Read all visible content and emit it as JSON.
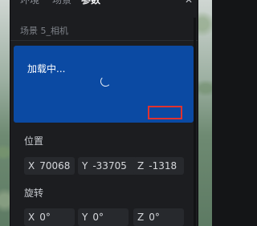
{
  "tabs": [
    {
      "label": "环境"
    },
    {
      "label": "场景"
    },
    {
      "label": "参数"
    }
  ],
  "close_icon": "close-icon",
  "scene_title": "场景 5_相机",
  "preview": {
    "status_text": "加载中...",
    "spinner_icon": "spinner-icon",
    "background_color": "#0b4aa3",
    "highlight_color": "#e0322f"
  },
  "position": {
    "label": "位置",
    "x": {
      "axis": "X",
      "value": "70068"
    },
    "y": {
      "axis": "Y",
      "value": "-33705"
    },
    "z": {
      "axis": "Z",
      "value": "-1318"
    }
  },
  "rotation": {
    "label": "旋转",
    "x": {
      "axis": "X",
      "value": "0°"
    },
    "y": {
      "axis": "Y",
      "value": "0°"
    },
    "z": {
      "axis": "Z",
      "value": "0°"
    }
  }
}
